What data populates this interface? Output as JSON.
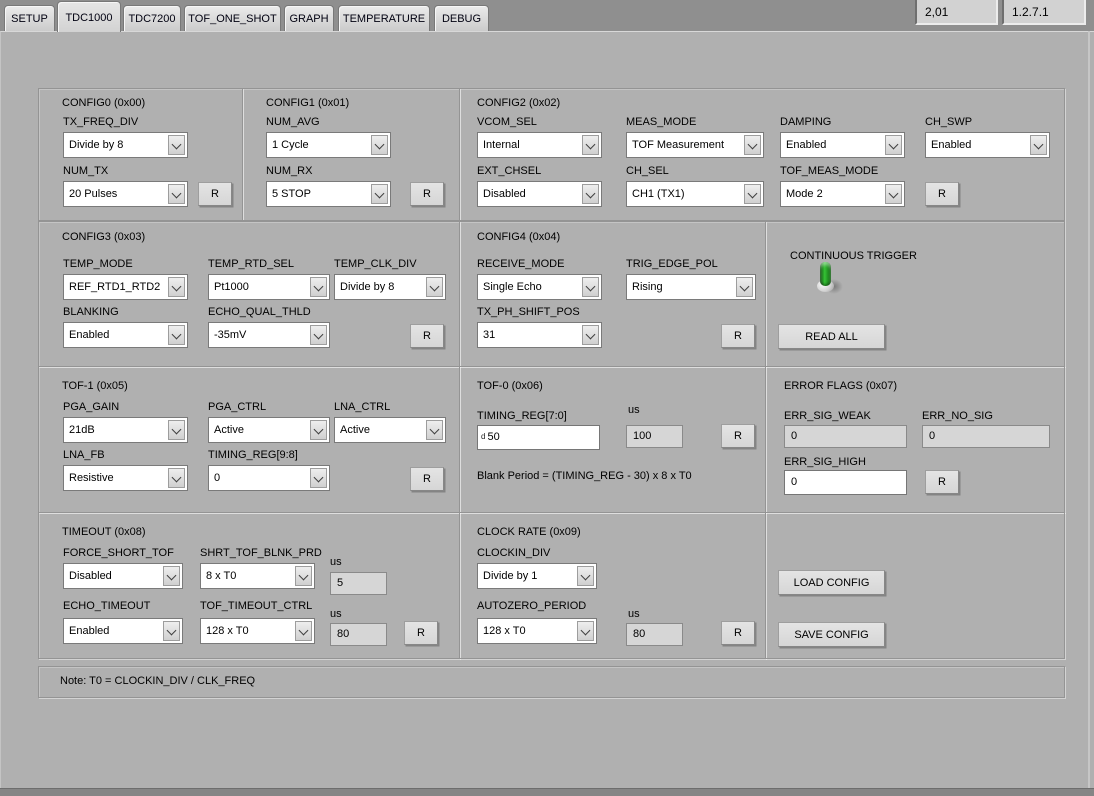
{
  "titlebar": {
    "left_value": "2,01",
    "right_value": "1.2.7.1"
  },
  "tabs": {
    "items": [
      "SETUP",
      "TDC1000",
      "TDC7200",
      "TOF_ONE_SHOT",
      "GRAPH",
      "TEMPERATURE",
      "DEBUG"
    ],
    "selected": "TDC1000"
  },
  "r_label": "R",
  "colors": {
    "led_green": "#35c335"
  },
  "groups": {
    "config0": {
      "title": "CONFIG0 (0x00)",
      "tx_freq_div": {
        "label": "TX_FREQ_DIV",
        "value": "Divide by 8"
      },
      "num_tx": {
        "label": "NUM_TX",
        "value": "20 Pulses"
      }
    },
    "config1": {
      "title": "CONFIG1 (0x01)",
      "num_avg": {
        "label": "NUM_AVG",
        "value": "1 Cycle"
      },
      "num_rx": {
        "label": "NUM_RX",
        "value": "5 STOP"
      }
    },
    "config2": {
      "title": "CONFIG2 (0x02)",
      "vcom_sel": {
        "label": "VCOM_SEL",
        "value": "Internal"
      },
      "meas_mode": {
        "label": "MEAS_MODE",
        "value": "TOF Measurement"
      },
      "damping": {
        "label": "DAMPING",
        "value": "Enabled"
      },
      "ch_swp": {
        "label": "CH_SWP",
        "value": "Enabled"
      },
      "ext_chsel": {
        "label": "EXT_CHSEL",
        "value": "Disabled"
      },
      "ch_sel": {
        "label": "CH_SEL",
        "value": "CH1 (TX1)"
      },
      "tof_meas_mode": {
        "label": "TOF_MEAS_MODE",
        "value": "Mode 2"
      }
    },
    "config3": {
      "title": "CONFIG3 (0x03)",
      "temp_mode": {
        "label": "TEMP_MODE",
        "value": "REF_RTD1_RTD2"
      },
      "temp_rtd_sel": {
        "label": "TEMP_RTD_SEL",
        "value": "Pt1000"
      },
      "temp_clk_div": {
        "label": "TEMP_CLK_DIV",
        "value": "Divide by 8"
      },
      "blanking": {
        "label": "BLANKING",
        "value": "Enabled"
      },
      "echo_qual_thld": {
        "label": "ECHO_QUAL_THLD",
        "value": "-35mV"
      }
    },
    "config4": {
      "title": "CONFIG4 (0x04)",
      "receive_mode": {
        "label": "RECEIVE_MODE",
        "value": "Single Echo"
      },
      "trig_edge_pol": {
        "label": "TRIG_EDGE_POL",
        "value": "Rising"
      },
      "tx_ph_shift_pos": {
        "label": "TX_PH_SHIFT_POS",
        "value": "31"
      }
    },
    "trigger": {
      "label": "CONTINUOUS TRIGGER",
      "read_all": "READ ALL"
    },
    "tof1": {
      "title": "TOF-1 (0x05)",
      "pga_gain": {
        "label": "PGA_GAIN",
        "value": "21dB"
      },
      "pga_ctrl": {
        "label": "PGA_CTRL",
        "value": "Active"
      },
      "lna_ctrl": {
        "label": "LNA_CTRL",
        "value": "Active"
      },
      "lna_fb": {
        "label": "LNA_FB",
        "value": "Resistive"
      },
      "timing_reg_98": {
        "label": "TIMING_REG[9:8]",
        "value": "0"
      }
    },
    "tof0": {
      "title": "TOF-0 (0x06)",
      "timing_reg": {
        "label": "TIMING_REG[7:0]",
        "radix": "d",
        "value": "50"
      },
      "us": {
        "label": "us",
        "value": "100"
      },
      "formula": "Blank Period = (TIMING_REG - 30) x 8 x T0"
    },
    "error_flags": {
      "title": "ERROR FLAGS (0x07)",
      "err_sig_weak": {
        "label": "ERR_SIG_WEAK",
        "value": "0"
      },
      "err_no_sig": {
        "label": "ERR_NO_SIG",
        "value": "0"
      },
      "err_sig_high": {
        "label": "ERR_SIG_HIGH",
        "value": "0"
      }
    },
    "timeout": {
      "title": "TIMEOUT (0x08)",
      "force_short_tof": {
        "label": "FORCE_SHORT_TOF",
        "value": "Disabled"
      },
      "shrt_tof_blnk_prd": {
        "label": "SHRT_TOF_BLNK_PRD",
        "value": "8 x T0"
      },
      "us1": {
        "label": "us",
        "value": "5"
      },
      "echo_timeout": {
        "label": "ECHO_TIMEOUT",
        "value": "Enabled"
      },
      "tof_timeout_ctrl": {
        "label": "TOF_TIMEOUT_CTRL",
        "value": "128 x T0"
      },
      "us2": {
        "label": "us",
        "value": "80"
      }
    },
    "clock_rate": {
      "title": "CLOCK RATE (0x09)",
      "clockin_div": {
        "label": "CLOCKIN_DIV",
        "value": "Divide by 1"
      },
      "autozero_period": {
        "label": "AUTOZERO_PERIOD",
        "value": "128 x T0"
      },
      "us": {
        "label": "us",
        "value": "80"
      }
    },
    "file_ops": {
      "load": "LOAD CONFIG",
      "save": "SAVE CONFIG"
    },
    "note": "Note: T0 = CLOCKIN_DIV / CLK_FREQ"
  }
}
